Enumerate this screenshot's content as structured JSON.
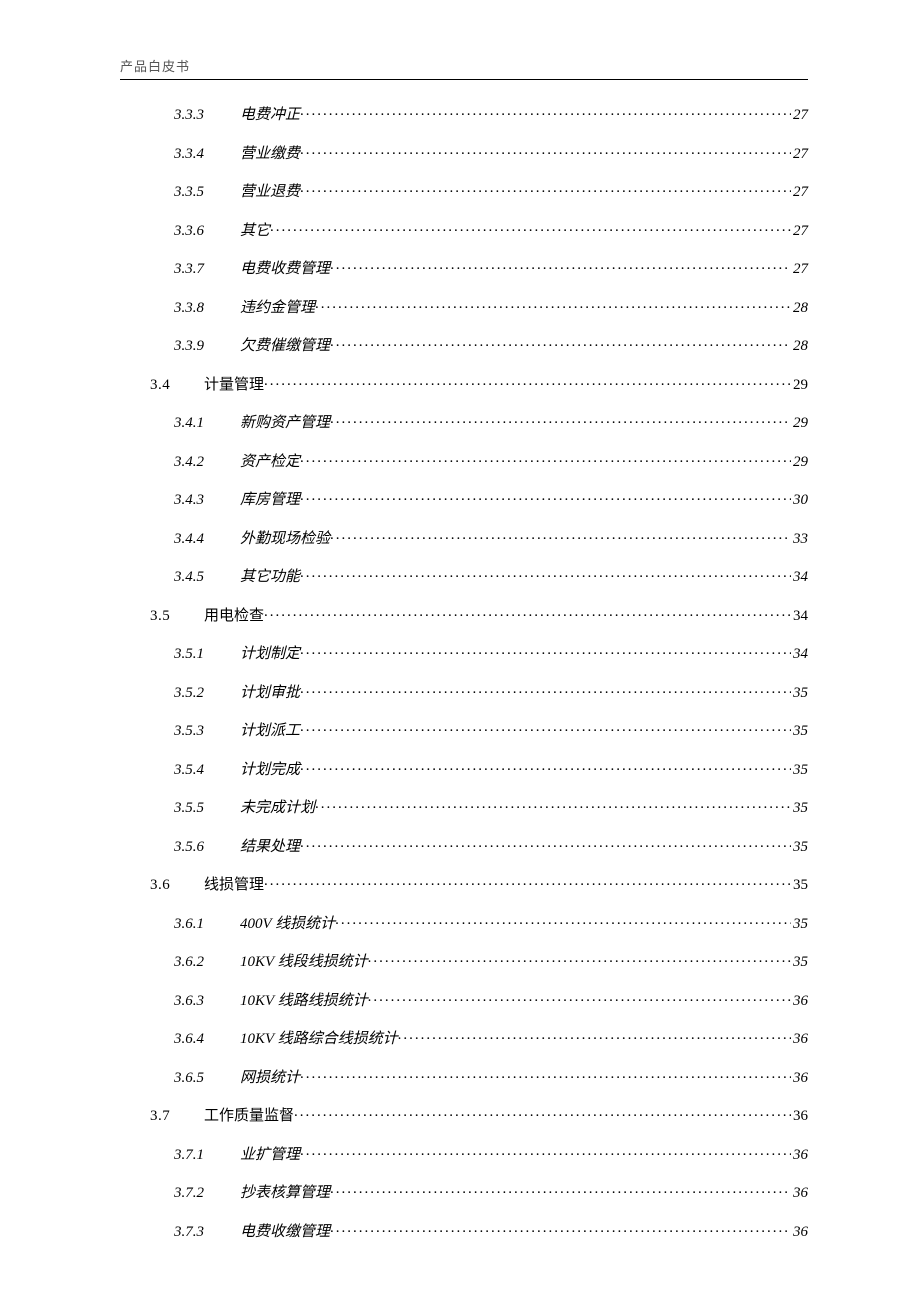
{
  "header": "产品白皮书",
  "toc": [
    {
      "level": 3,
      "num": "3.3.3",
      "title": "电费冲正",
      "page": "27"
    },
    {
      "level": 3,
      "num": "3.3.4",
      "title": "营业缴费",
      "page": "27"
    },
    {
      "level": 3,
      "num": "3.3.5",
      "title": "营业退费",
      "page": "27"
    },
    {
      "level": 3,
      "num": "3.3.6",
      "title": "其它",
      "page": "27"
    },
    {
      "level": 3,
      "num": "3.3.7",
      "title": "电费收费管理",
      "page": "27"
    },
    {
      "level": 3,
      "num": "3.3.8",
      "title": "违约金管理",
      "page": "28"
    },
    {
      "level": 3,
      "num": "3.3.9",
      "title": "欠费催缴管理",
      "page": "28"
    },
    {
      "level": 2,
      "num": "3.4",
      "title": "计量管理",
      "page": "29"
    },
    {
      "level": 3,
      "num": "3.4.1",
      "title": "新购资产管理",
      "page": "29"
    },
    {
      "level": 3,
      "num": "3.4.2",
      "title": "资产检定",
      "page": "29"
    },
    {
      "level": 3,
      "num": "3.4.3",
      "title": "库房管理",
      "page": "30"
    },
    {
      "level": 3,
      "num": "3.4.4",
      "title": "外勤现场检验",
      "page": "33"
    },
    {
      "level": 3,
      "num": "3.4.5",
      "title": "其它功能",
      "page": "34"
    },
    {
      "level": 2,
      "num": "3.5",
      "title": "用电检查",
      "page": "34"
    },
    {
      "level": 3,
      "num": "3.5.1",
      "title": "计划制定",
      "page": "34"
    },
    {
      "level": 3,
      "num": "3.5.2",
      "title": "计划审批",
      "page": "35"
    },
    {
      "level": 3,
      "num": "3.5.3",
      "title": "计划派工",
      "page": "35"
    },
    {
      "level": 3,
      "num": "3.5.4",
      "title": "计划完成",
      "page": "35"
    },
    {
      "level": 3,
      "num": "3.5.5",
      "title": "未完成计划",
      "page": "35"
    },
    {
      "level": 3,
      "num": "3.5.6",
      "title": "结果处理",
      "page": "35"
    },
    {
      "level": 2,
      "num": "3.6",
      "title": "线损管理",
      "page": "35"
    },
    {
      "level": 3,
      "num": "3.6.1",
      "title": "400V 线损统计",
      "page": "35"
    },
    {
      "level": 3,
      "num": "3.6.2",
      "title": "10KV 线段线损统计",
      "page": "35"
    },
    {
      "level": 3,
      "num": "3.6.3",
      "title": "10KV 线路线损统计",
      "page": "36"
    },
    {
      "level": 3,
      "num": "3.6.4",
      "title": "10KV 线路综合线损统计",
      "page": "36"
    },
    {
      "level": 3,
      "num": "3.6.5",
      "title": "网损统计",
      "page": "36"
    },
    {
      "level": 2,
      "num": "3.7",
      "title": "工作质量监督",
      "page": "36"
    },
    {
      "level": 3,
      "num": "3.7.1",
      "title": "业扩管理",
      "page": "36"
    },
    {
      "level": 3,
      "num": "3.7.2",
      "title": "抄表核算管理",
      "page": "36"
    },
    {
      "level": 3,
      "num": "3.7.3",
      "title": "电费收缴管理",
      "page": "36"
    }
  ]
}
